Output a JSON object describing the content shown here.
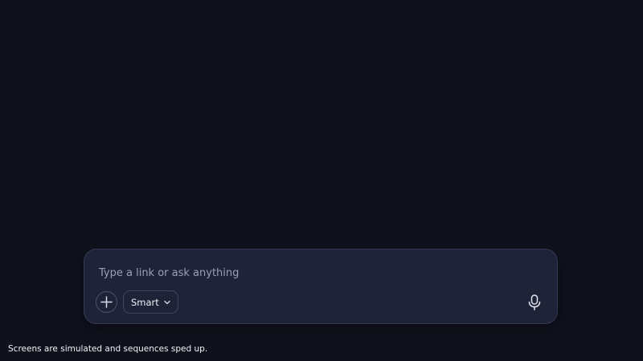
{
  "composer": {
    "placeholder": "Type a link or ask anything",
    "value": "",
    "add_icon": "plus-icon",
    "mode_selector": {
      "selected": "Smart",
      "icon": "chevron-down-icon"
    },
    "mic_icon": "microphone-icon"
  },
  "footer": {
    "disclaimer": "Screens are simulated and sequences sped up."
  },
  "colors": {
    "background": "#0f111c",
    "composer_background": "#1f2337",
    "composer_border": "#343a52",
    "placeholder_text": "#9aa0b8"
  }
}
